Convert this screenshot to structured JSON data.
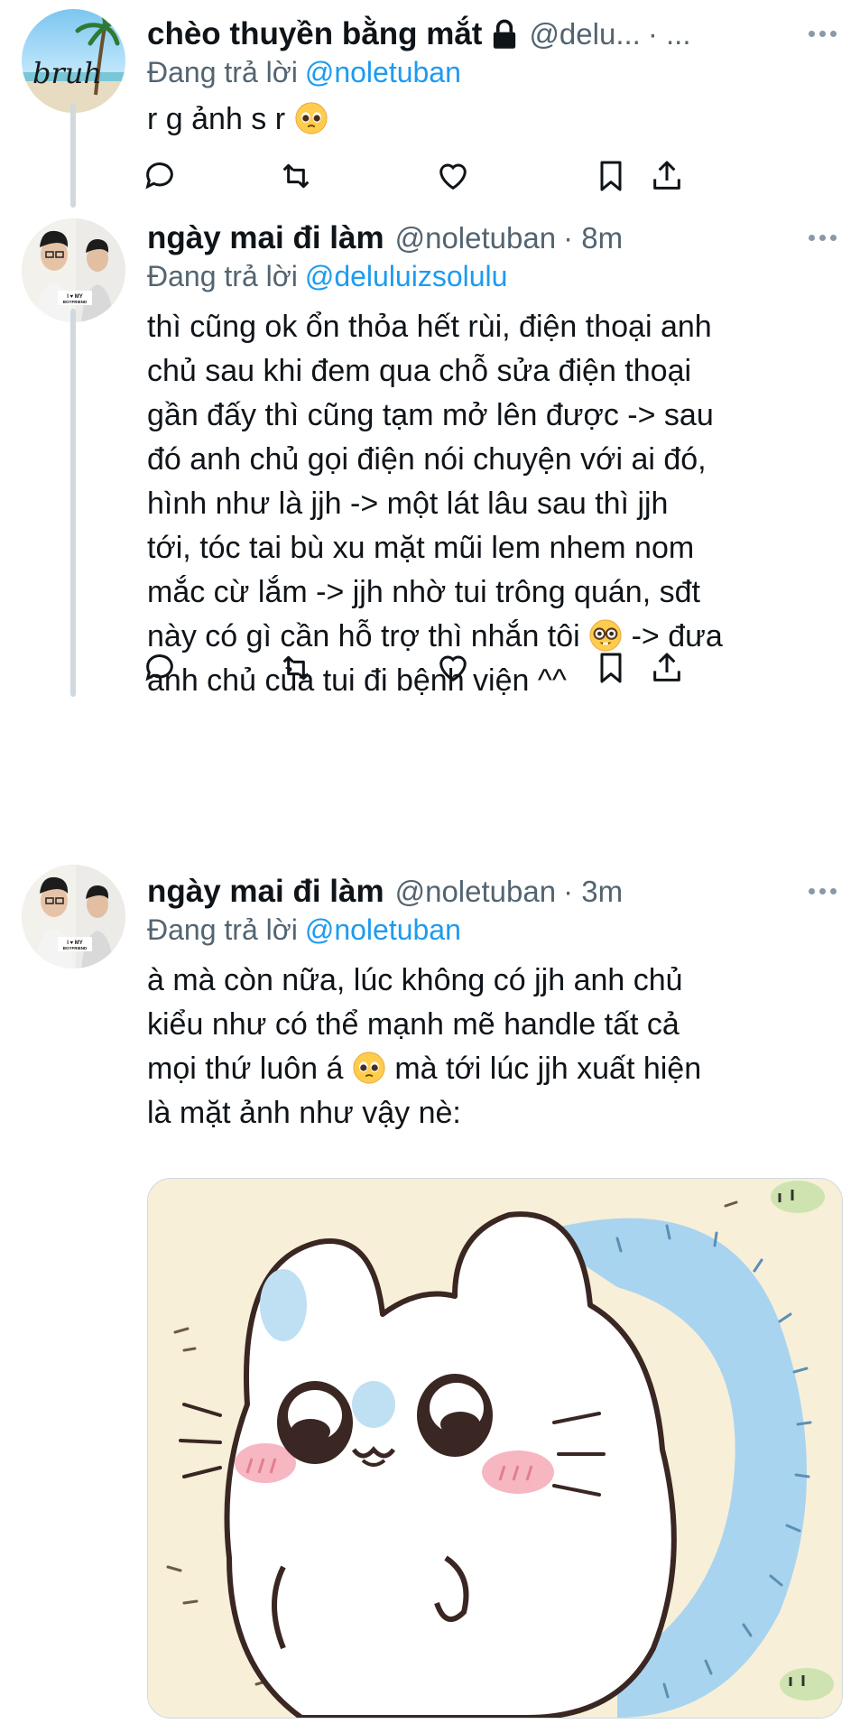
{
  "tweets": [
    {
      "name": "chèo thuyền bằng mắt",
      "handle": "@delu...",
      "time": "· ...",
      "reply_prefix": "Đang trả lời",
      "reply_to": "@noletuban",
      "body": "r g ảnh s r",
      "avatar_text": "bruh"
    },
    {
      "name": "ngày mai đi làm",
      "handle": "@noletuban",
      "time": "· 8m",
      "reply_prefix": "Đang trả lời",
      "reply_to": "@deluluizsolulu",
      "body_lines": [
        "thì cũng ok ổn thỏa hết rùi, điện thoại anh",
        "chủ sau khi đem qua chỗ sửa điện thoại",
        "gần đấy thì cũng tạm mở lên được -> sau",
        "đó anh chủ gọi điện nói chuyện với ai đó,",
        "hình như là jjh -> một lát lâu sau thì jjh",
        "tới, tóc tai bù xu mặt mũi lem nhem nom",
        "mắc cừ lắm -> jjh nhờ tui trông quán, sđt",
        "này có gì cần hỗ trợ thì nhắn tôi",
        "-> đưa",
        "anh chủ của tui đi bệnh viện ^^"
      ]
    },
    {
      "name": "ngày mai đi làm",
      "handle": "@noletuban",
      "time": "· 3m",
      "reply_prefix": "Đang trả lời",
      "reply_to": "@noletuban",
      "body_lines": [
        "à mà còn nữa, lúc không có jjh anh chủ",
        "kiểu như có thể mạnh mẽ handle tất cả",
        "mọi thứ luôn á",
        "mà tới lúc jjh xuất hiện",
        "là mặt ảnh như vậy nè:"
      ]
    }
  ],
  "colors": {
    "text": "#0f1419",
    "secondary": "#536471",
    "accent": "#1d9bf0",
    "thread_line": "#cfd9de"
  },
  "icons": [
    "lock-icon",
    "more-icon",
    "reply-icon",
    "retweet-icon",
    "like-icon",
    "bookmark-icon",
    "share-icon",
    "pleading-face-emoji",
    "nerd-face-emoji"
  ]
}
